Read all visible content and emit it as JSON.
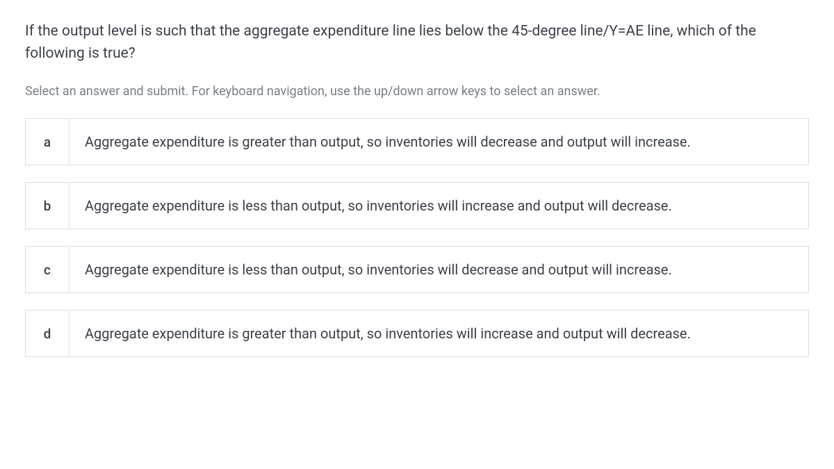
{
  "question": "If the output level is such that the aggregate expenditure line lies below the 45-degree line/Y=AE line, which of the following is true?",
  "instructions": "Select an answer and submit. For keyboard navigation, use the up/down arrow keys to select an answer.",
  "options": [
    {
      "letter": "a",
      "text": "Aggregate expenditure is greater than output, so inventories will decrease and output will increase."
    },
    {
      "letter": "b",
      "text": "Aggregate expenditure is less than output, so inventories will increase and output will decrease."
    },
    {
      "letter": "c",
      "text": "Aggregate expenditure is less than output, so inventories will decrease and output will increase."
    },
    {
      "letter": "d",
      "text": "Aggregate expenditure is greater than output, so inventories will increase and output will decrease."
    }
  ]
}
